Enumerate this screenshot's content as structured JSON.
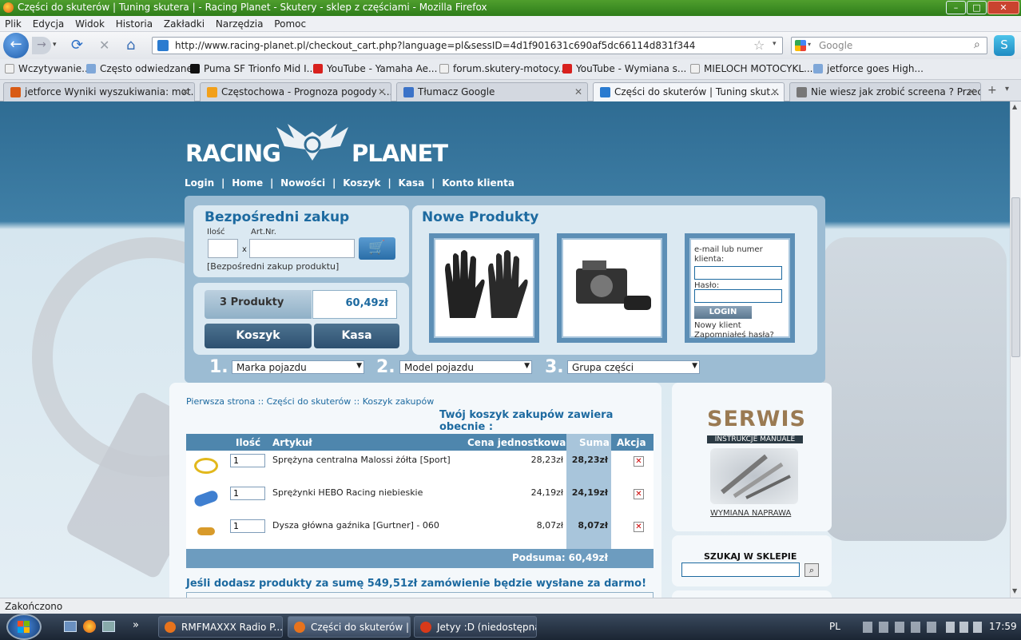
{
  "window": {
    "title": "Części do skuterów | Tuning skutera | - Racing Planet - Skutery - sklep z częściami - Mozilla Firefox",
    "min": "–",
    "max": "□",
    "close": "✕"
  },
  "menu": [
    "Plik",
    "Edycja",
    "Widok",
    "Historia",
    "Zakładki",
    "Narzędzia",
    "Pomoc"
  ],
  "url": "http://www.racing-planet.pl/checkout_cart.php?language=pl&sessID=4d1f901631c690af5dc66114d831f344",
  "search_placeholder": "Google",
  "bookmarks": [
    {
      "label": "Wczytywanie...",
      "color": "#f0f0f0"
    },
    {
      "label": "Często odwiedzane",
      "color": "#7fa7d8"
    },
    {
      "label": "Puma SF Trionfo Mid I...",
      "color": "#111111"
    },
    {
      "label": "YouTube - Yamaha Ae...",
      "color": "#d8211e"
    },
    {
      "label": "forum.skutery-motocy...",
      "color": "#f0f0f0"
    },
    {
      "label": "YouTube - Wymiana s...",
      "color": "#d8211e"
    },
    {
      "label": "MIELOCH MOTOCYKL...",
      "color": "#f0f0f0"
    },
    {
      "label": "jetforce goes High...",
      "color": "#7fa7d8"
    }
  ],
  "tabs": [
    {
      "label": "jetforce Wyniki wyszukiwania: mot...",
      "color": "#d85a14",
      "active": false
    },
    {
      "label": "Częstochowa - Prognoza pogody -...",
      "color": "#f2a01a",
      "active": false
    },
    {
      "label": "Tłumacz Google",
      "color": "#3b73c8",
      "active": false
    },
    {
      "label": "Części do skuterów | Tuning skut...",
      "color": "#2a7bd0",
      "active": true
    },
    {
      "label": "Nie wiesz jak zrobić screena ? Przec...",
      "color": "#777777",
      "active": false
    }
  ],
  "site": {
    "logo_left": "RACING",
    "logo_right": "PLANET",
    "nav": [
      "Login",
      "Home",
      "Nowości",
      "Koszyk",
      "Kasa",
      "Konto klienta"
    ],
    "nav_sep": "|"
  },
  "direct": {
    "title": "Bezpośredni zakup",
    "qty_label": "Ilość",
    "art_label": "Art.Nr.",
    "times": "x",
    "link": "[Bezpośredni zakup produktu]"
  },
  "cart_summary": {
    "count": "3 Produkty",
    "total": "60,49zł",
    "cart_btn": "Koszyk",
    "checkout_btn": "Kasa"
  },
  "new_products": {
    "title": "Nowe Produkty"
  },
  "login": {
    "email_label": "e-mail lub numer klienta:",
    "password_label": "Hasło:",
    "button": "LOGIN",
    "new_client": "Nowy klient",
    "forgot": "Zapomniałeś hasła?"
  },
  "filters": [
    {
      "num": "1.",
      "label": "Marka pojazdu"
    },
    {
      "num": "2.",
      "label": "Model pojazdu"
    },
    {
      "num": "3.",
      "label": "Grupa części"
    }
  ],
  "breadcrumb": [
    "Pierwsza strona",
    "Części do skuterów",
    "Koszyk zakupów"
  ],
  "breadcrumb_sep": "::",
  "cart_heading": "Twój koszyk zakupów zawiera obecnie :",
  "cart_headers": [
    "Ilość",
    "Artykuł",
    "Cena jednostkowa",
    "Suma",
    "Akcja"
  ],
  "cart_rows": [
    {
      "qty": "1",
      "name": "Sprężyna centralna Malossi żółta [Sport]",
      "price": "28,23zł",
      "sum": "28,23zł",
      "icon_color": "#e2b81c"
    },
    {
      "qty": "1",
      "name": "Sprężynki HEBO Racing niebieskie",
      "price": "24,19zł",
      "sum": "24,19zł",
      "icon_color": "#3f7fd0"
    },
    {
      "qty": "1",
      "name": "Dysza główna gaźnika [Gurtner] - 060",
      "price": "8,07zł",
      "sum": "8,07zł",
      "icon_color": "#d89a2a"
    }
  ],
  "subtotal_label": "Podsuma:",
  "subtotal": "60,49zł",
  "free_shipping": "Jeśli dodasz produkty za sumę 549,51zł zamówienie będzie wysłane za darmo!",
  "delete_glyph": "✕",
  "serwis": {
    "title": "SERWIS",
    "subtitle": "INSTRUKCJE MANUALE",
    "link": "WYMIANA NAPRAWA"
  },
  "shop_search": {
    "title": "SZUKAJ W SKLEPIE"
  },
  "status": "Zakończono",
  "taskbar": {
    "items": [
      {
        "label": "RMFMAXXX Radio P...",
        "color": "#e8731c",
        "active": false
      },
      {
        "label": "Części do skuterów |...",
        "color": "#e8731c",
        "active": true
      },
      {
        "label": "Jetyy :D (niedostępna)",
        "color": "#d83a1a",
        "active": false
      }
    ],
    "lang": "PL",
    "clock": "17:59"
  }
}
